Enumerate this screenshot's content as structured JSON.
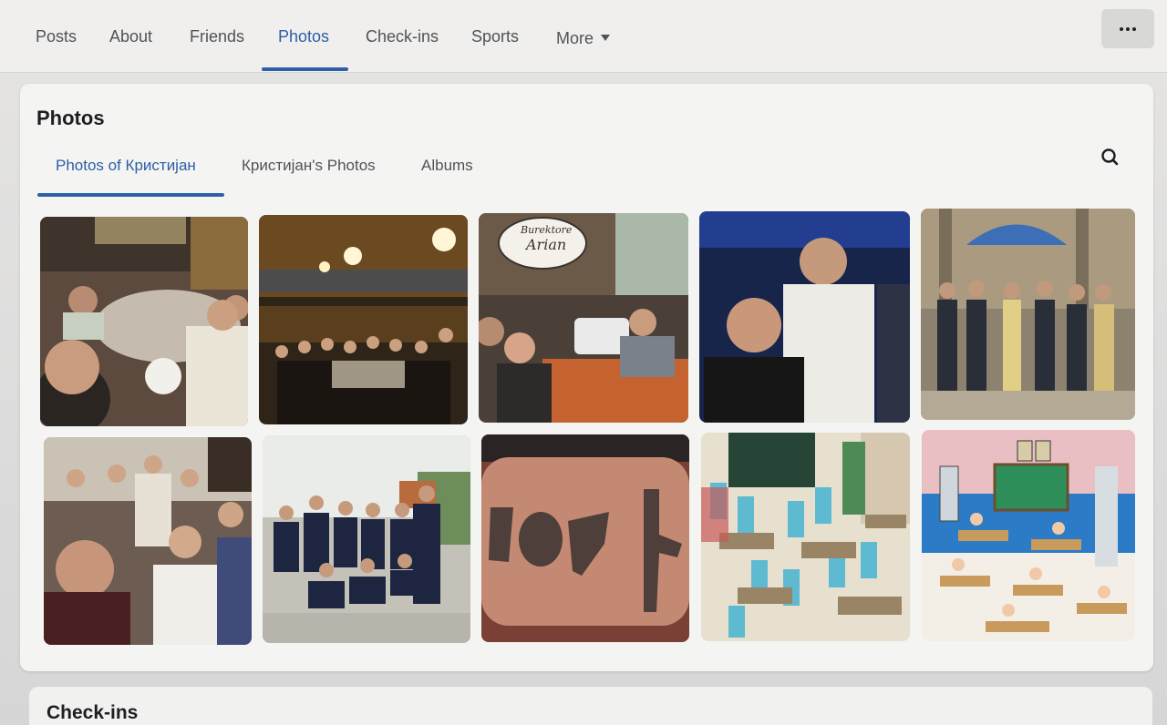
{
  "profile_nav": {
    "tabs": [
      {
        "label": "Posts"
      },
      {
        "label": "About"
      },
      {
        "label": "Friends"
      },
      {
        "label": "Photos"
      },
      {
        "label": "Check-ins"
      },
      {
        "label": "Sports"
      },
      {
        "label": "More"
      }
    ],
    "active_tab": "Photos"
  },
  "photos_section": {
    "title": "Photos",
    "subtabs": [
      {
        "label": "Photos of Кристијан"
      },
      {
        "label": "Кристијан's Photos"
      },
      {
        "label": "Albums"
      }
    ],
    "active_subtab": "Photos of Кристијан",
    "photos": [
      {
        "description": "group selfie at restaurant table"
      },
      {
        "description": "large group at long dinner table"
      },
      {
        "description": "restaurant selfie",
        "sign": "Burektore Arian"
      },
      {
        "description": "two men selfie at night"
      },
      {
        "description": "group standing in front of church"
      },
      {
        "description": "party group selfie"
      },
      {
        "description": "youth team in navy shirts"
      },
      {
        "description": "tattoo on arm"
      },
      {
        "description": "cartoon classroom with chalkboard"
      },
      {
        "description": "cartoon classroom illustration"
      }
    ]
  },
  "checkins_section": {
    "title": "Check-ins"
  },
  "colors": {
    "accent": "#2d5fa8",
    "text": "#1c1e21",
    "muted": "#505357"
  },
  "icons": {
    "more": "chevron-down-icon",
    "options": "ellipsis-icon",
    "search": "search-icon"
  }
}
